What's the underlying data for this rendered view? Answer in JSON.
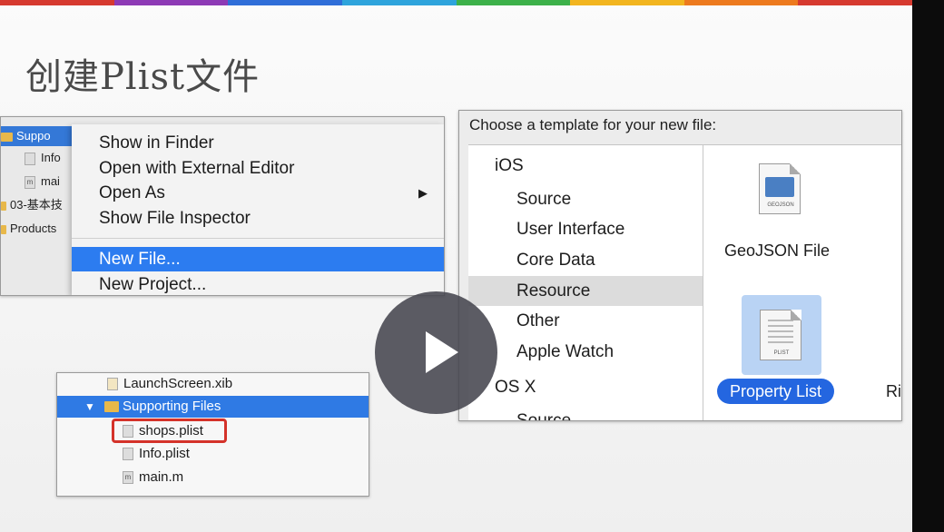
{
  "slide": {
    "title": "创建Plist文件",
    "stripe_colors": [
      "#d63a2f",
      "#8d3ab5",
      "#2f6ed8",
      "#2ea4dc",
      "#3db14a",
      "#f2b51f",
      "#ed7a1e",
      "#d63a2f"
    ]
  },
  "context_panel": {
    "tree": [
      {
        "label": "Suppo",
        "kind": "folder",
        "selected": true
      },
      {
        "label": "Info",
        "kind": "file",
        "icon": "plist-file-icon"
      },
      {
        "label": "mai",
        "kind": "file",
        "icon": "m-file-icon",
        "badge": "m"
      },
      {
        "label": "03-基本技",
        "kind": "folder"
      },
      {
        "label": "Products",
        "kind": "folder"
      }
    ],
    "menu": [
      {
        "label": "Show in Finder"
      },
      {
        "label": "Open with External Editor"
      },
      {
        "label": "Open As",
        "submenu_glyph": "▶"
      },
      {
        "label": "Show File Inspector"
      },
      {
        "label": "New File...",
        "highlighted": true
      },
      {
        "label": "New Project..."
      }
    ]
  },
  "template_panel": {
    "heading": "Choose a template for your new file:",
    "categories": [
      {
        "label": "iOS",
        "level": 0
      },
      {
        "label": "Source",
        "level": 1
      },
      {
        "label": "User Interface",
        "level": 1
      },
      {
        "label": "Core Data",
        "level": 1
      },
      {
        "label": "Resource",
        "level": 1,
        "selected": true
      },
      {
        "label": "Other",
        "level": 1
      },
      {
        "label": "Apple Watch",
        "level": 1
      },
      {
        "label": "OS X",
        "level": 0
      },
      {
        "label": "Source",
        "level": 1
      }
    ],
    "templates": [
      {
        "label": "GeoJSON File",
        "icon_text": "GEOJSON",
        "icon": "geojson-file-icon"
      },
      {
        "label": "Property List",
        "icon_text": "PLIST",
        "icon": "plist-file-icon",
        "selected": true
      },
      {
        "label": "Ri"
      }
    ]
  },
  "navigator_panel": {
    "rows": [
      {
        "label": "LaunchScreen.xib",
        "icon": "xib-file-icon"
      },
      {
        "label": "Supporting Files",
        "icon": "folder-icon",
        "selected": true,
        "disclosure": "▼"
      },
      {
        "label": "shops.plist",
        "icon": "plist-file-icon",
        "highlighted_box": true
      },
      {
        "label": "Info.plist",
        "icon": "plist-file-icon"
      },
      {
        "label": "main.m",
        "icon": "m-file-icon",
        "badge": "m"
      }
    ]
  },
  "video": {
    "play_icon": "play-icon",
    "overlay_color": "#46464e"
  }
}
